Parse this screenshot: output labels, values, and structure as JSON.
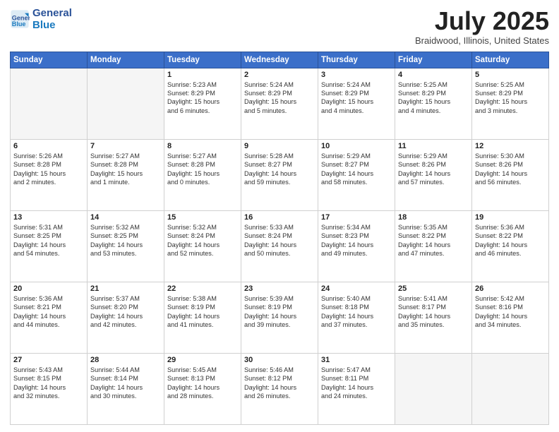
{
  "logo": {
    "line1": "General",
    "line2": "Blue"
  },
  "title": "July 2025",
  "location": "Braidwood, Illinois, United States",
  "days_of_week": [
    "Sunday",
    "Monday",
    "Tuesday",
    "Wednesday",
    "Thursday",
    "Friday",
    "Saturday"
  ],
  "weeks": [
    [
      {
        "day": "",
        "info": ""
      },
      {
        "day": "",
        "info": ""
      },
      {
        "day": "1",
        "info": "Sunrise: 5:23 AM\nSunset: 8:29 PM\nDaylight: 15 hours\nand 6 minutes."
      },
      {
        "day": "2",
        "info": "Sunrise: 5:24 AM\nSunset: 8:29 PM\nDaylight: 15 hours\nand 5 minutes."
      },
      {
        "day": "3",
        "info": "Sunrise: 5:24 AM\nSunset: 8:29 PM\nDaylight: 15 hours\nand 4 minutes."
      },
      {
        "day": "4",
        "info": "Sunrise: 5:25 AM\nSunset: 8:29 PM\nDaylight: 15 hours\nand 4 minutes."
      },
      {
        "day": "5",
        "info": "Sunrise: 5:25 AM\nSunset: 8:29 PM\nDaylight: 15 hours\nand 3 minutes."
      }
    ],
    [
      {
        "day": "6",
        "info": "Sunrise: 5:26 AM\nSunset: 8:28 PM\nDaylight: 15 hours\nand 2 minutes."
      },
      {
        "day": "7",
        "info": "Sunrise: 5:27 AM\nSunset: 8:28 PM\nDaylight: 15 hours\nand 1 minute."
      },
      {
        "day": "8",
        "info": "Sunrise: 5:27 AM\nSunset: 8:28 PM\nDaylight: 15 hours\nand 0 minutes."
      },
      {
        "day": "9",
        "info": "Sunrise: 5:28 AM\nSunset: 8:27 PM\nDaylight: 14 hours\nand 59 minutes."
      },
      {
        "day": "10",
        "info": "Sunrise: 5:29 AM\nSunset: 8:27 PM\nDaylight: 14 hours\nand 58 minutes."
      },
      {
        "day": "11",
        "info": "Sunrise: 5:29 AM\nSunset: 8:26 PM\nDaylight: 14 hours\nand 57 minutes."
      },
      {
        "day": "12",
        "info": "Sunrise: 5:30 AM\nSunset: 8:26 PM\nDaylight: 14 hours\nand 56 minutes."
      }
    ],
    [
      {
        "day": "13",
        "info": "Sunrise: 5:31 AM\nSunset: 8:25 PM\nDaylight: 14 hours\nand 54 minutes."
      },
      {
        "day": "14",
        "info": "Sunrise: 5:32 AM\nSunset: 8:25 PM\nDaylight: 14 hours\nand 53 minutes."
      },
      {
        "day": "15",
        "info": "Sunrise: 5:32 AM\nSunset: 8:24 PM\nDaylight: 14 hours\nand 52 minutes."
      },
      {
        "day": "16",
        "info": "Sunrise: 5:33 AM\nSunset: 8:24 PM\nDaylight: 14 hours\nand 50 minutes."
      },
      {
        "day": "17",
        "info": "Sunrise: 5:34 AM\nSunset: 8:23 PM\nDaylight: 14 hours\nand 49 minutes."
      },
      {
        "day": "18",
        "info": "Sunrise: 5:35 AM\nSunset: 8:22 PM\nDaylight: 14 hours\nand 47 minutes."
      },
      {
        "day": "19",
        "info": "Sunrise: 5:36 AM\nSunset: 8:22 PM\nDaylight: 14 hours\nand 46 minutes."
      }
    ],
    [
      {
        "day": "20",
        "info": "Sunrise: 5:36 AM\nSunset: 8:21 PM\nDaylight: 14 hours\nand 44 minutes."
      },
      {
        "day": "21",
        "info": "Sunrise: 5:37 AM\nSunset: 8:20 PM\nDaylight: 14 hours\nand 42 minutes."
      },
      {
        "day": "22",
        "info": "Sunrise: 5:38 AM\nSunset: 8:19 PM\nDaylight: 14 hours\nand 41 minutes."
      },
      {
        "day": "23",
        "info": "Sunrise: 5:39 AM\nSunset: 8:19 PM\nDaylight: 14 hours\nand 39 minutes."
      },
      {
        "day": "24",
        "info": "Sunrise: 5:40 AM\nSunset: 8:18 PM\nDaylight: 14 hours\nand 37 minutes."
      },
      {
        "day": "25",
        "info": "Sunrise: 5:41 AM\nSunset: 8:17 PM\nDaylight: 14 hours\nand 35 minutes."
      },
      {
        "day": "26",
        "info": "Sunrise: 5:42 AM\nSunset: 8:16 PM\nDaylight: 14 hours\nand 34 minutes."
      }
    ],
    [
      {
        "day": "27",
        "info": "Sunrise: 5:43 AM\nSunset: 8:15 PM\nDaylight: 14 hours\nand 32 minutes."
      },
      {
        "day": "28",
        "info": "Sunrise: 5:44 AM\nSunset: 8:14 PM\nDaylight: 14 hours\nand 30 minutes."
      },
      {
        "day": "29",
        "info": "Sunrise: 5:45 AM\nSunset: 8:13 PM\nDaylight: 14 hours\nand 28 minutes."
      },
      {
        "day": "30",
        "info": "Sunrise: 5:46 AM\nSunset: 8:12 PM\nDaylight: 14 hours\nand 26 minutes."
      },
      {
        "day": "31",
        "info": "Sunrise: 5:47 AM\nSunset: 8:11 PM\nDaylight: 14 hours\nand 24 minutes."
      },
      {
        "day": "",
        "info": ""
      },
      {
        "day": "",
        "info": ""
      }
    ]
  ]
}
